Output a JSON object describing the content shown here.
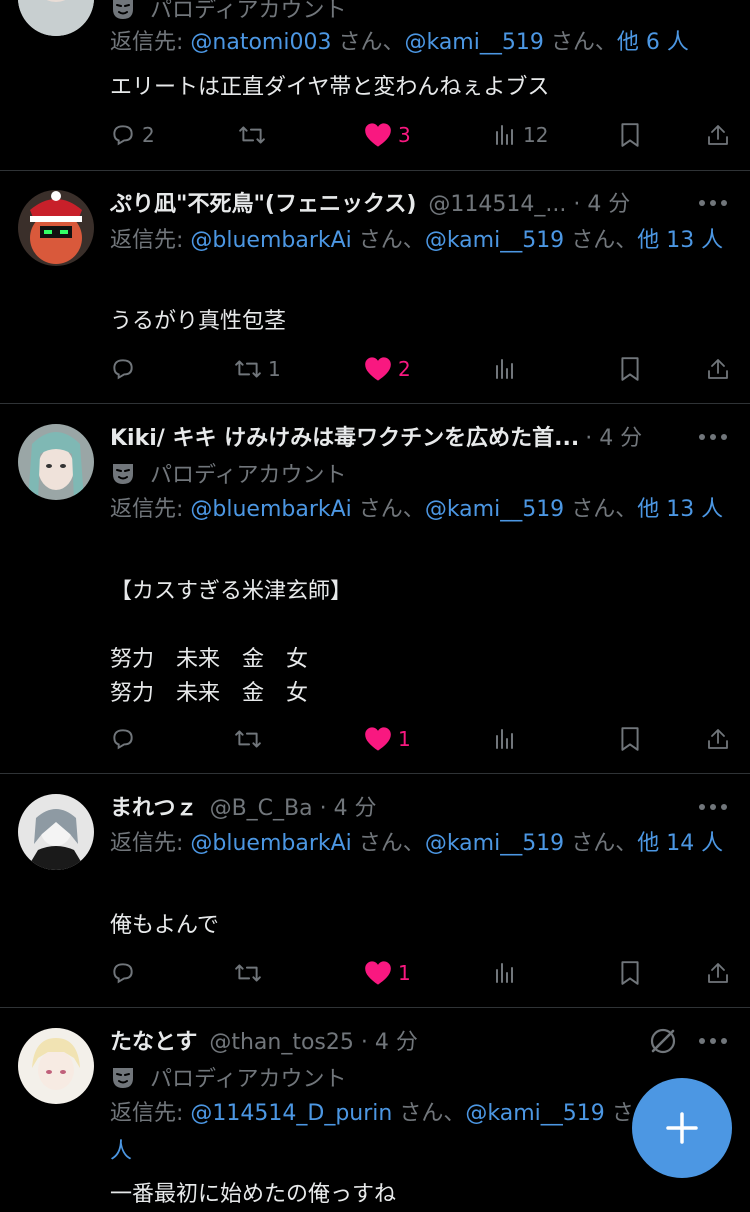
{
  "tweets": [
    {
      "parody_label": "パロディアカウント",
      "reply_prefix": "返信先: ",
      "mentions": [
        "@natomi003",
        "@kami__519"
      ],
      "sep": "さん、",
      "others": "他 6 人",
      "text": "エリートは正直ダイヤ帯と変わんねぇよブス",
      "reply_count": "2",
      "retweet_count": "",
      "like_count": "3",
      "view_count": "12"
    },
    {
      "name": "ぷり凪\"不死鳥\"(フェニックス)",
      "handle_time": "@114514_... · 4 分",
      "reply_prefix": "返信先: ",
      "mentions": [
        "@bluembarkAi",
        "@kami__519"
      ],
      "sep": "さん、",
      "others": "他 13 人",
      "text": "うるがり真性包茎",
      "reply_count": "",
      "retweet_count": "1",
      "like_count": "2",
      "view_count": ""
    },
    {
      "name": "Kiki/ キキ けみけみは毒ワクチンを広めた首...",
      "handle_time": "· 4 分",
      "parody_label": "パロディアカウント",
      "reply_prefix": "返信先: ",
      "mentions": [
        "@bluembarkAi",
        "@kami__519"
      ],
      "sep": "さん、",
      "others": "他 13 人",
      "text": "【カスすぎる米津玄師】\n\n努力　未来　金　女\n努力　未来　金　女",
      "reply_count": "",
      "retweet_count": "",
      "like_count": "1",
      "view_count": ""
    },
    {
      "name": "まれつｚ",
      "handle_time": "@B_C_Ba · 4 分",
      "reply_prefix": "返信先: ",
      "mentions": [
        "@bluembarkAi",
        "@kami__519"
      ],
      "sep": "さん、",
      "others": "他 14 人",
      "text": "俺もよんで",
      "reply_count": "",
      "retweet_count": "",
      "like_count": "1",
      "view_count": ""
    },
    {
      "name": "たなとす",
      "handle_time": "@than_tos25 · 4 分",
      "parody_label": "パロディアカウント",
      "reply_prefix": "返信先: ",
      "mentions": [
        "@114514_D_purin",
        "@kami__519"
      ],
      "sep": "さん、",
      "others": "他 6 人",
      "text": "一番最初に始めたの俺っすね"
    }
  ],
  "colors": {
    "background": "#000000",
    "text": "#e7e9ea",
    "muted": "#71767b",
    "mention": "#4c97e3",
    "like": "#f91880",
    "divider": "#2f3336",
    "fab": "#4c97e3"
  },
  "icons": {
    "reply": "reply-icon",
    "retweet": "retweet-icon",
    "like": "heart-icon",
    "views": "views-icon",
    "bookmark": "bookmark-icon",
    "share": "share-icon",
    "more": "more-icon",
    "parody": "mask-icon",
    "compose": "plus-icon",
    "grok": "grok-icon"
  }
}
